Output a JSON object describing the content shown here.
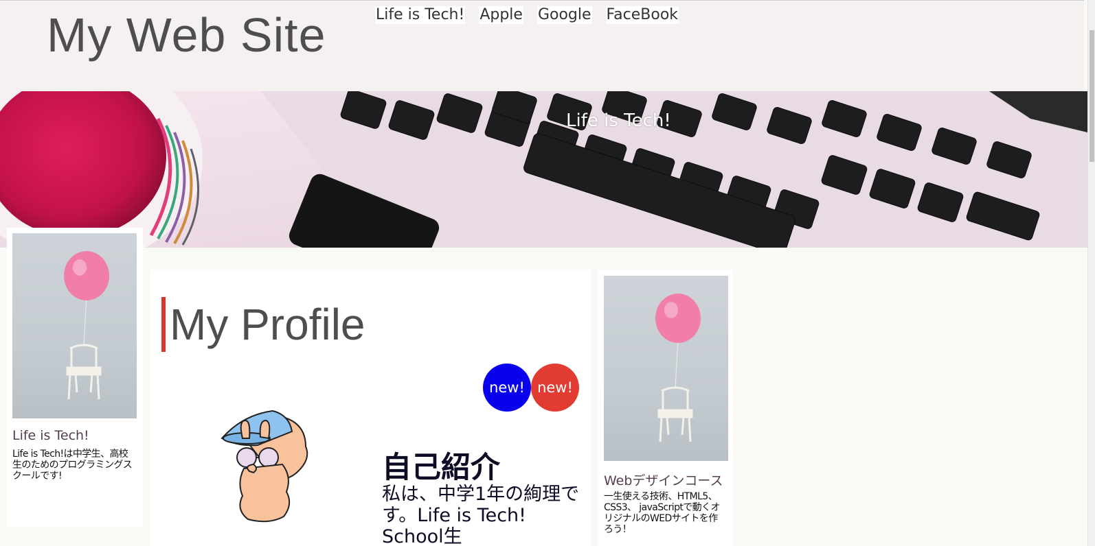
{
  "header": {
    "site_title": "My Web Site",
    "nav": [
      "Life is Tech!",
      "Apple",
      "Google",
      "FaceBook"
    ]
  },
  "hero": {
    "title": "Life is Tech!"
  },
  "left_card": {
    "title": "Life is Tech!",
    "text": "Life is Tech!は中学生、高校生のためのプログラミングスクールです!"
  },
  "right_card": {
    "title": "Webデザインコース",
    "text": "一生使える技術、HTML5、CSS3、 javaScriptで動くオリジナルのWEDサイトを作ろう！"
  },
  "main": {
    "heading": "My Profile",
    "badges": [
      "new!",
      "new!"
    ],
    "intro_heading": "自己紹介",
    "intro_text": "私は、中学1年の絢理です。Life is Tech! School生"
  },
  "colors": {
    "heading_accent": "#d9352a",
    "badge_blue": "#0a00ee",
    "badge_red": "#e23c32",
    "header_bg": "#f4f1f0"
  }
}
